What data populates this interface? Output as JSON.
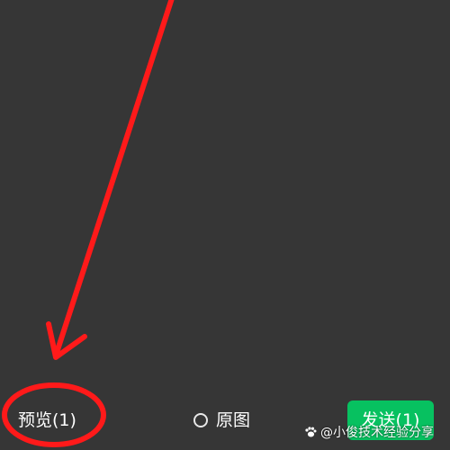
{
  "colors": {
    "background": "#363636",
    "annotation": "#ff1a1a",
    "send_button": "#07c160",
    "text": "#ffffff"
  },
  "bottom_bar": {
    "preview_label": "预览(1)",
    "original_label": "原图",
    "original_checked": false,
    "send_label": "发送(1)"
  },
  "watermark": {
    "logo_icon": "paw-logo-icon",
    "text": "@小俊技术经验分享"
  }
}
